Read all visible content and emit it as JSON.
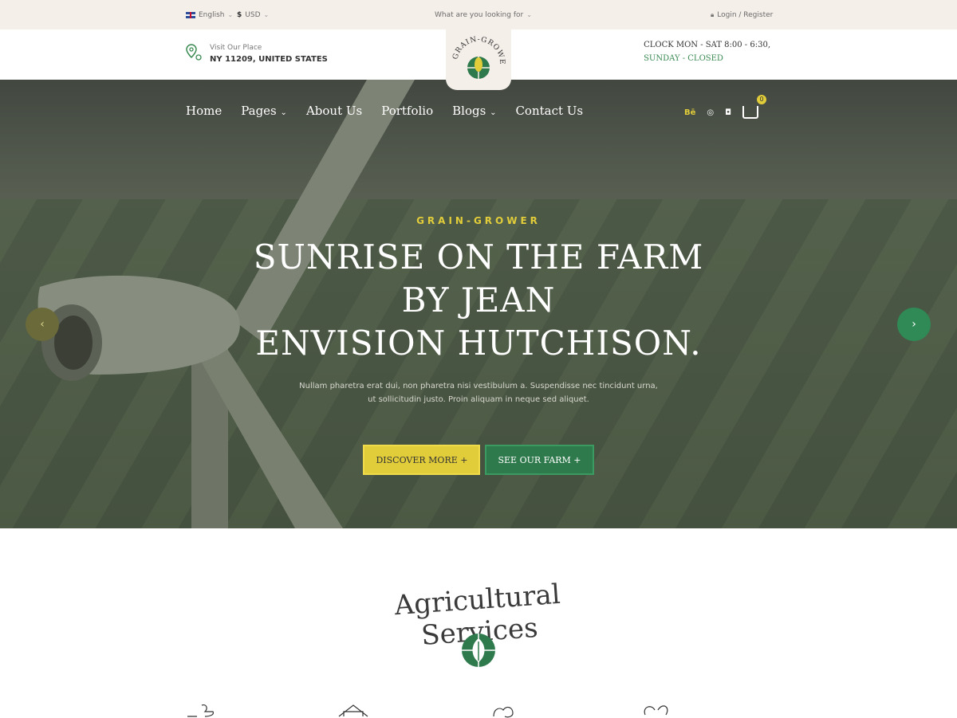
{
  "topbar": {
    "language": "English",
    "currency": "USD",
    "search_placeholder": "What are you looking for",
    "login": "Login / Register"
  },
  "info": {
    "location_label": "Visit Our Place",
    "location_value": "NY 11209, UNITED STATES",
    "hours_line1": "CLOCK  MON - SAT 8:00 - 6:30,",
    "hours_line2": "SUNDAY - CLOSED"
  },
  "nav": {
    "items": [
      "Home",
      "Pages",
      "About Us",
      "Portfolio",
      "Blogs",
      "Contact Us"
    ],
    "social_behance": "Bē",
    "cart_count": "0"
  },
  "hero": {
    "eyebrow": "GRAIN-GROWER",
    "headline_1": "SUNRISE ON THE FARM BY JEAN",
    "headline_2": "ENVISION HUTCHISON.",
    "subtext": "Nullam pharetra erat dui, non pharetra nisi vestibulum a. Suspendisse nec tincidunt urna, ut sollicitudin justo. Proin aliquam in neque sed aliquet.",
    "btn_primary": "DISCOVER MORE +",
    "btn_secondary": "SEE OUR FARM  +"
  },
  "services": {
    "title": "Agricultural Services"
  },
  "colors": {
    "accent_yellow": "#e1cc3a",
    "accent_green": "#2f7a4c",
    "topbar_bg": "#f5efea"
  },
  "icons": [
    "flag-uk-icon",
    "dollar-icon",
    "lock-icon",
    "map-pin-icon",
    "behance-icon",
    "dribbble-icon",
    "instagram-icon",
    "cart-icon",
    "chevron-left-icon",
    "chevron-right-icon",
    "leaf-globe-icon"
  ]
}
